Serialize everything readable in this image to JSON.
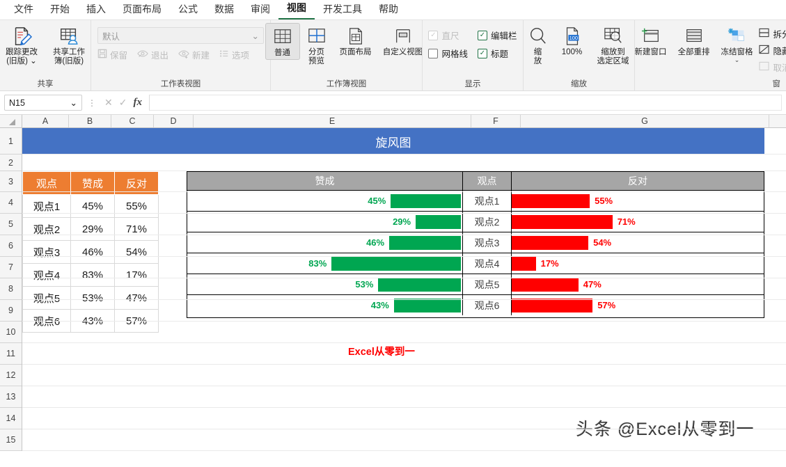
{
  "ribbon_tabs": [
    {
      "label": "文件",
      "active": false
    },
    {
      "label": "开始",
      "active": false
    },
    {
      "label": "插入",
      "active": false
    },
    {
      "label": "页面布局",
      "active": false
    },
    {
      "label": "公式",
      "active": false
    },
    {
      "label": "数据",
      "active": false
    },
    {
      "label": "审阅",
      "active": false
    },
    {
      "label": "视图",
      "active": true
    },
    {
      "label": "开发工具",
      "active": false
    },
    {
      "label": "帮助",
      "active": false
    }
  ],
  "groups": {
    "share": {
      "label": "共享",
      "buttons": [
        {
          "line1": "跟踪更改",
          "line2": "(旧版)",
          "caret": "⌄",
          "icon": "track-changes-icon"
        },
        {
          "line1": "共享工作",
          "line2": "簿(旧版)",
          "icon": "share-workbook-icon"
        }
      ]
    },
    "sheet_view": {
      "label": "工作表视图",
      "combo_value": "默认",
      "combo_caret": "⌄",
      "buttons": [
        {
          "label": "保留",
          "icon": "save-icon"
        },
        {
          "label": "退出",
          "icon": "exit-view-icon"
        },
        {
          "label": "新建",
          "icon": "new-view-icon"
        },
        {
          "label": "选项",
          "icon": "options-list-icon"
        }
      ]
    },
    "workbook_view": {
      "label": "工作簿视图",
      "buttons": [
        {
          "line1": "普通",
          "line2": "",
          "selected": true,
          "icon": "normal-view-icon"
        },
        {
          "line1": "分页",
          "line2": "预览",
          "selected": false,
          "icon": "page-break-preview-icon"
        },
        {
          "line1": "页面布局",
          "line2": "",
          "selected": false,
          "icon": "page-layout-icon"
        },
        {
          "line1": "自定义视图",
          "line2": "",
          "selected": false,
          "icon": "custom-view-icon"
        }
      ]
    },
    "show": {
      "label": "显示",
      "checkboxes": [
        {
          "label": "直尺",
          "checked": true,
          "disabled": true,
          "mark": "✓"
        },
        {
          "label": "编辑栏",
          "checked": true,
          "disabled": false,
          "mark": "✓"
        },
        {
          "label": "网格线",
          "checked": false,
          "disabled": false,
          "mark": ""
        },
        {
          "label": "标题",
          "checked": true,
          "disabled": false,
          "mark": "✓"
        }
      ]
    },
    "zoom": {
      "label": "缩放",
      "buttons": [
        {
          "line1": "缩",
          "line2": "放",
          "icon": "zoom-magnifier-icon",
          "badge": ""
        },
        {
          "line1": "100%",
          "line2": "",
          "icon": "zoom-100-icon",
          "badge": "100"
        },
        {
          "line1": "缩放到",
          "line2": "选定区域",
          "icon": "zoom-selection-icon",
          "badge": ""
        }
      ]
    },
    "window": {
      "label": "窗",
      "buttons": [
        {
          "line1": "新建窗口",
          "line2": "",
          "icon": "new-window-icon"
        },
        {
          "line1": "全部重排",
          "line2": "",
          "icon": "arrange-all-icon"
        },
        {
          "line1": "冻结窗格",
          "line2": "",
          "icon": "freeze-panes-icon",
          "caret": "⌄"
        }
      ],
      "small_buttons": [
        {
          "label": "拆分",
          "disabled": false,
          "icon": "split-icon"
        },
        {
          "label": "隐藏",
          "disabled": false,
          "icon": "hide-icon"
        },
        {
          "label": "取消",
          "disabled": true,
          "icon": "unhide-icon"
        }
      ]
    }
  },
  "formula_bar": {
    "name_box": "N15",
    "name_caret": "⌄",
    "cancel_icon": "✕",
    "confirm_icon": "✓",
    "fx_label": "fx",
    "formula_value": ""
  },
  "grid": {
    "columns": [
      "A",
      "B",
      "C",
      "D",
      "E",
      "F",
      "G"
    ],
    "rows": [
      "1",
      "2",
      "3",
      "4",
      "5",
      "6",
      "7",
      "8",
      "9",
      "10",
      "11",
      "12",
      "13",
      "14",
      "15"
    ]
  },
  "sheet": {
    "title": "旋风图",
    "footnote": "Excel从零到一",
    "watermark": "头条 @Excel从零到一",
    "data_table": {
      "headers": [
        "观点",
        "赞成",
        "反对"
      ],
      "rows": [
        [
          "观点1",
          "45%",
          "55%"
        ],
        [
          "观点2",
          "29%",
          "71%"
        ],
        [
          "观点3",
          "46%",
          "54%"
        ],
        [
          "观点4",
          "83%",
          "17%"
        ],
        [
          "观点5",
          "53%",
          "47%"
        ],
        [
          "观点6",
          "43%",
          "57%"
        ]
      ]
    }
  },
  "chart_data": {
    "type": "bar",
    "title": "旋风图",
    "subtype": "tornado",
    "headers": [
      "赞成",
      "观点",
      "反对"
    ],
    "categories": [
      "观点1",
      "观点2",
      "观点3",
      "观点4",
      "观点5",
      "观点6"
    ],
    "series": [
      {
        "name": "赞成",
        "color": "#00a651",
        "values": [
          45,
          29,
          46,
          83,
          53,
          43
        ],
        "labels": [
          "45%",
          "29%",
          "46%",
          "83%",
          "53%",
          "43%"
        ]
      },
      {
        "name": "反对",
        "color": "#ff0000",
        "values": [
          55,
          71,
          54,
          17,
          47,
          57
        ],
        "labels": [
          "55%",
          "71%",
          "54%",
          "17%",
          "47%",
          "57%"
        ]
      }
    ],
    "xlabel": "",
    "ylabel": "",
    "xlim": [
      0,
      100
    ],
    "unit": "%",
    "grid": false,
    "legend": false,
    "header_color": "#a6a6a6"
  },
  "colors": {
    "banner": "#4472c4",
    "table_header": "#ed7d31",
    "approve": "#00a651",
    "oppose": "#ff0000",
    "chart_header": "#a6a6a6",
    "accent_tab": "#217346"
  }
}
